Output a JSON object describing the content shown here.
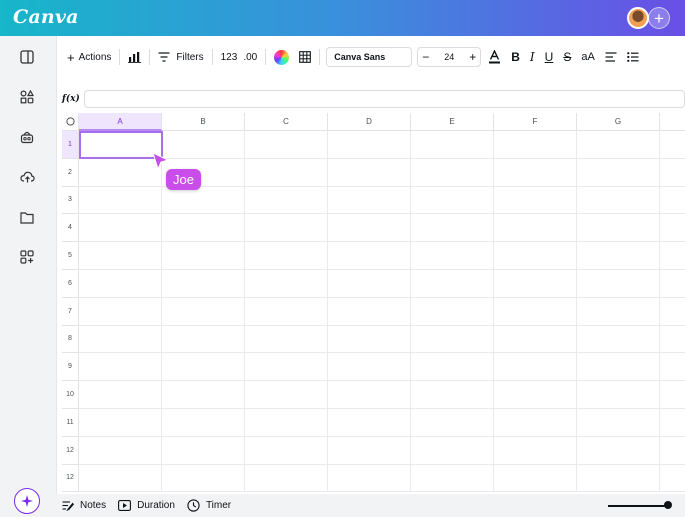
{
  "app": {
    "logo": "Canva"
  },
  "header": {
    "add_label": "+"
  },
  "toolbar": {
    "actions_label": "Actions",
    "filters_label": "Filters",
    "number_format": "123",
    "decimal_format": ".00",
    "font_name": "Canva Sans",
    "font_size": "24",
    "decrease": "−",
    "increase": "+",
    "case_label": "aA"
  },
  "formula": {
    "label": "f(x)",
    "value": ""
  },
  "grid": {
    "columns": [
      "A",
      "B",
      "C",
      "D",
      "E",
      "F",
      "G"
    ],
    "rows": [
      "1",
      "2",
      "3",
      "4",
      "5",
      "6",
      "7",
      "8",
      "9",
      "10",
      "11",
      "12",
      "12"
    ],
    "selected_cell": "A1"
  },
  "collaborator": {
    "name": "Joe",
    "color": "#c94de8"
  },
  "footer": {
    "notes": "Notes",
    "duration": "Duration",
    "timer": "Timer"
  },
  "colors": {
    "accent": "#7d2ae8",
    "selection": "#efe6fd"
  }
}
